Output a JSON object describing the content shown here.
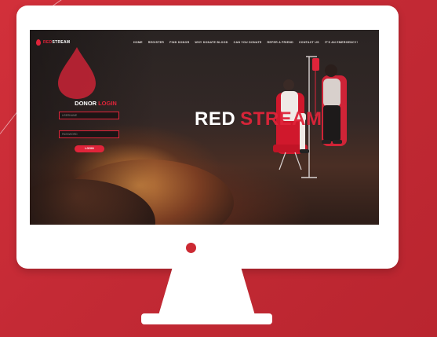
{
  "brand": {
    "red": "RED",
    "white": "STREAM",
    "logo_icon": "blood-drop-icon"
  },
  "nav": {
    "items": [
      "HOME",
      "REGISTER",
      "FIND DONOR",
      "WHY DONATE BLOOD",
      "CAN YOU DONATE",
      "REFER A FRIEND",
      "CONTACT US",
      "IT'S AN EMERGENCY!"
    ]
  },
  "login": {
    "title_white": "DONOR",
    "title_red": "LOGIN",
    "username_placeholder": "USERNAME",
    "password_placeholder": "PASSWORD",
    "button": "LOGIN"
  },
  "hero": {
    "white": "RED",
    "red": "STREAM"
  },
  "colors": {
    "background": "#c62c36",
    "accent": "#e0243a",
    "monitor": "#ffffff"
  }
}
